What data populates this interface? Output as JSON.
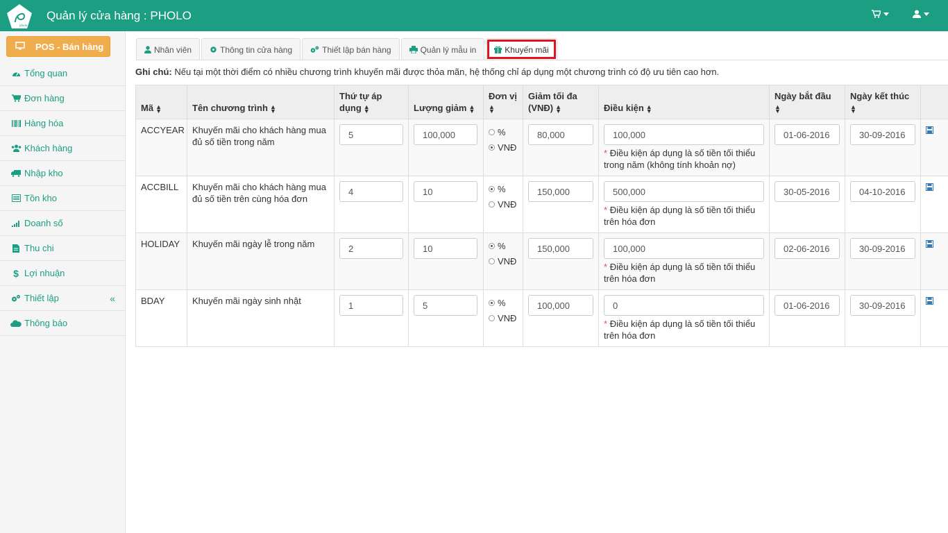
{
  "app": {
    "title": "Quản lý cửa hàng : PHOLO",
    "logo_text": "pholo"
  },
  "colors": {
    "primary": "#1b9e81",
    "pos_button": "#f0ad4e",
    "active_tab_outline": "#e0141e"
  },
  "header": {
    "cart_icon": "cart-icon",
    "user_icon": "user-icon"
  },
  "sidebar": {
    "pos_label": "POS - Bán hàng",
    "items": [
      {
        "label": "Tổng quan",
        "icon": "dashboard-icon"
      },
      {
        "label": "Đơn hàng",
        "icon": "cart-icon"
      },
      {
        "label": "Hàng hóa",
        "icon": "barcode-icon"
      },
      {
        "label": "Khách hàng",
        "icon": "users-icon"
      },
      {
        "label": "Nhập kho",
        "icon": "truck-icon"
      },
      {
        "label": "Tồn kho",
        "icon": "list-icon"
      },
      {
        "label": "Doanh số",
        "icon": "signal-icon"
      },
      {
        "label": "Thu chi",
        "icon": "file-icon"
      },
      {
        "label": "Lợi nhuận",
        "icon": "dollar-icon"
      },
      {
        "label": "Thiết lập",
        "icon": "gears-icon",
        "chevron": "«"
      },
      {
        "label": "Thông báo",
        "icon": "cloud-icon"
      }
    ]
  },
  "tabs": [
    {
      "label": "Nhân viên"
    },
    {
      "label": "Thông tin cửa hàng"
    },
    {
      "label": "Thiết lập bán hàng"
    },
    {
      "label": "Quản lý mẫu in"
    },
    {
      "label": "Khuyến mãi",
      "active": true
    }
  ],
  "note": {
    "prefix": "Ghi chú:",
    "text": "Nếu tại một thời điểm có nhiều chương trình khuyến mãi được thỏa mãn, hệ thống chỉ áp dụng một chương trình có độ ưu tiên cao hơn."
  },
  "table": {
    "headers": {
      "code": "Mã",
      "name": "Tên chương trình",
      "priority": "Thứ tự áp dụng",
      "amount": "Lượng giảm",
      "unit": "Đơn vị",
      "max": "Giảm tối đa (VNĐ)",
      "condition": "Điều kiện",
      "start": "Ngày bắt đầu",
      "end": "Ngày kết thúc"
    },
    "unit_options": [
      "%",
      "VNĐ"
    ],
    "rows": [
      {
        "code": "ACCYEAR",
        "name": "Khuyến mãi cho khách hàng mua đủ số tiền trong năm",
        "priority": "5",
        "amount": "100,000",
        "unit": "VNĐ",
        "max": "80,000",
        "condition": "100,000",
        "hint": "Điều kiện áp dụng là số tiền tối thiểu trong năm (không tính khoản nợ)",
        "start": "01-06-2016",
        "end": "30-09-2016"
      },
      {
        "code": "ACCBILL",
        "name": "Khuyến mãi cho khách hàng mua đủ số tiền trên cùng hóa đơn",
        "priority": "4",
        "amount": "10",
        "unit": "%",
        "max": "150,000",
        "condition": "500,000",
        "hint": "Điều kiện áp dụng là số tiền tối thiểu trên hóa đơn",
        "start": "30-05-2016",
        "end": "04-10-2016"
      },
      {
        "code": "HOLIDAY",
        "name": "Khuyến mãi ngày lễ trong năm",
        "priority": "2",
        "amount": "10",
        "unit": "%",
        "max": "150,000",
        "condition": "100,000",
        "hint": "Điều kiện áp dụng là số tiền tối thiểu trên hóa đơn",
        "start": "02-06-2016",
        "end": "30-09-2016"
      },
      {
        "code": "BDAY",
        "name": "Khuyến mãi ngày sinh nhật",
        "priority": "1",
        "amount": "5",
        "unit": "%",
        "max": "100,000",
        "condition": "0",
        "hint": "Điều kiện áp dụng là số tiền tối thiểu trên hóa đơn",
        "start": "01-06-2016",
        "end": "30-09-2016"
      }
    ]
  }
}
